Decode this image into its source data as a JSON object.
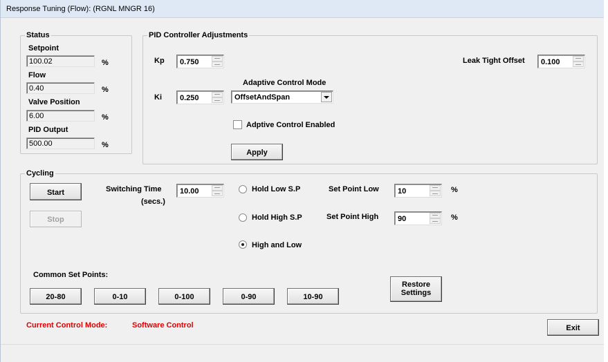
{
  "window": {
    "title": "Response Tuning (Flow): (RGNL MNGR 16)"
  },
  "status": {
    "title": "Status",
    "setpoint": {
      "label": "Setpoint",
      "value": "100.02",
      "unit": "%"
    },
    "flow": {
      "label": "Flow",
      "value": "0.40",
      "unit": "%"
    },
    "valve_position": {
      "label": "Valve Position",
      "value": "6.00",
      "unit": "%"
    },
    "pid_output": {
      "label": "PID Output",
      "value": "500.00",
      "unit": "%"
    }
  },
  "pid": {
    "title": "PID Controller Adjustments",
    "kp": {
      "label": "Kp",
      "value": "0.750"
    },
    "ki": {
      "label": "Ki",
      "value": "0.250"
    },
    "leak_tight_offset": {
      "label": "Leak Tight Offset",
      "value": "0.100"
    },
    "adaptive_mode": {
      "label": "Adaptive Control Mode",
      "value": "OffsetAndSpan"
    },
    "adaptive_enabled": {
      "label": "Adptive Control Enabled",
      "checked": false
    },
    "apply_label": "Apply"
  },
  "cycling": {
    "title": "Cycling",
    "start_label": "Start",
    "stop_label": "Stop",
    "switching_time": {
      "label": "Switching Time",
      "sublabel": "(secs.)",
      "value": "10.00"
    },
    "hold_low_label": "Hold Low S.P",
    "hold_high_label": "Hold High S.P",
    "high_and_low_label": "High and Low",
    "selected_mode": "High and Low",
    "set_point_low": {
      "label": "Set Point Low",
      "value": "10",
      "unit": "%"
    },
    "set_point_high": {
      "label": "Set Point High",
      "value": "90",
      "unit": "%"
    },
    "common_label": "Common Set Points:",
    "common_buttons": [
      "20-80",
      "0-10",
      "0-100",
      "0-90",
      "10-90"
    ],
    "restore_label_line1": "Restore",
    "restore_label_line2": "Settings"
  },
  "footer": {
    "mode_label": "Current Control Mode:",
    "mode_value": "Software Control",
    "exit_label": "Exit"
  },
  "colors": {
    "warning_text": "#e00000",
    "background": "#f0f0f0",
    "titlebar": "#dfe9f5"
  }
}
